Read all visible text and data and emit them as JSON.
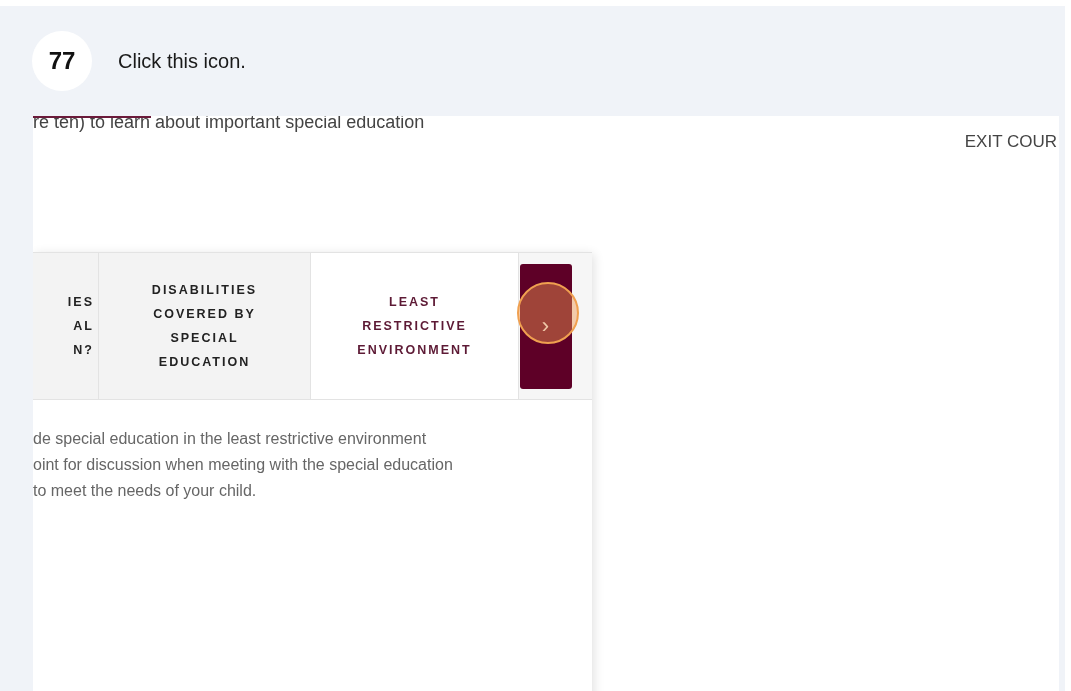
{
  "step": {
    "number": "77",
    "instruction": "Click this icon."
  },
  "screenshot": {
    "intro_text": "re ten) to learn about important special education",
    "exit_link": "EXIT COUR",
    "tabs": [
      {
        "lines": [
          "IES",
          "AL",
          "N?"
        ],
        "selected": false
      },
      {
        "lines": [
          "DISABILITIES",
          "COVERED BY",
          "SPECIAL",
          "EDUCATION"
        ],
        "selected": false
      },
      {
        "lines": [
          "LEAST",
          "RESTRICTIVE",
          "ENVIRONMENT"
        ],
        "selected": true
      }
    ],
    "next_button": {
      "label": "›"
    },
    "body_lines": [
      "de special education in the least restrictive environment",
      "oint for discussion when meeting with the special education",
      "to meet the needs of your child."
    ]
  }
}
